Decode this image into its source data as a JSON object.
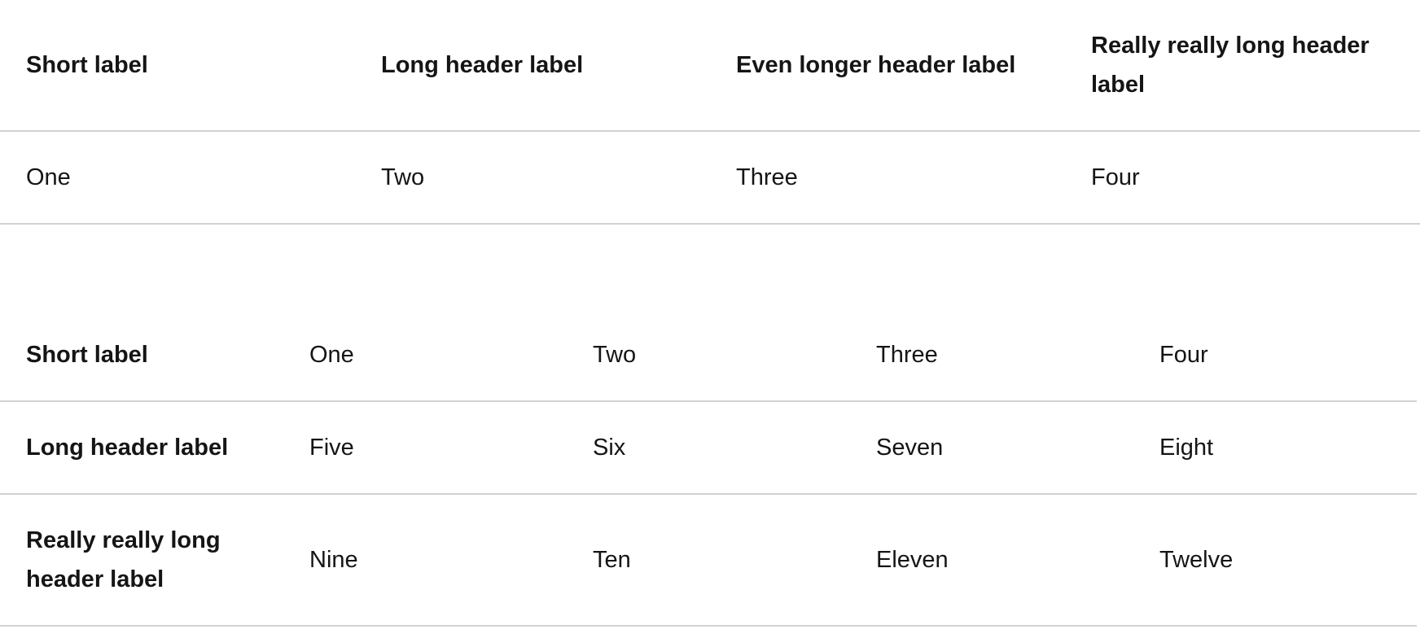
{
  "table_columns_header": {
    "headers": [
      "Short label",
      "Long header label",
      "Even longer header label",
      "Really really long header label"
    ],
    "rows": [
      [
        "One",
        "Two",
        "Three",
        "Four"
      ]
    ]
  },
  "table_rows_header": {
    "rows": [
      {
        "header": "Short label",
        "cells": [
          "One",
          "Two",
          "Three",
          "Four"
        ]
      },
      {
        "header": "Long header label",
        "cells": [
          "Five",
          "Six",
          "Seven",
          "Eight"
        ]
      },
      {
        "header": "Really really long header label",
        "cells": [
          "Nine",
          "Ten",
          "Eleven",
          "Twelve"
        ]
      }
    ]
  },
  "colors": {
    "text": "#151515",
    "border": "#d2d2d2",
    "background": "#ffffff"
  }
}
